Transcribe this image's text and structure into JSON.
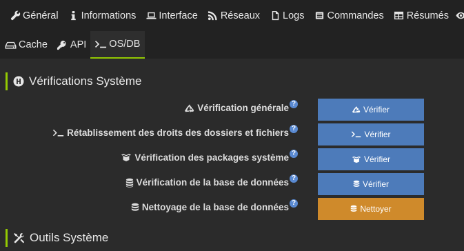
{
  "top_nav": [
    {
      "label": "Général",
      "icon": "wrench-icon"
    },
    {
      "label": "Informations",
      "icon": "info-icon"
    },
    {
      "label": "Interface",
      "icon": "laptop-icon"
    },
    {
      "label": "Réseaux",
      "icon": "rss-icon"
    },
    {
      "label": "Logs",
      "icon": "file-icon"
    },
    {
      "label": "Commandes",
      "icon": "list-icon"
    },
    {
      "label": "Résumés",
      "icon": "table-icon"
    }
  ],
  "sub_nav": [
    {
      "label": "Cache",
      "icon": "hdd-icon"
    },
    {
      "label": "API",
      "icon": "key-icon"
    },
    {
      "label": "OS/DB",
      "icon": "terminal-icon",
      "active": true
    }
  ],
  "sections": {
    "verifications_title": "Vérifications Système",
    "tools_title": "Outils Système"
  },
  "rows": [
    {
      "label": "Vérification générale",
      "icon": "recycle-icon",
      "button": "Vérifier",
      "button_icon": "recycle-icon"
    },
    {
      "label": "Rétablissement des droits des dossiers et fichiers",
      "icon": "terminal-icon",
      "button": "Vérifier",
      "button_icon": "terminal-icon"
    },
    {
      "label": "Vérification des packages système",
      "icon": "box-icon",
      "button": "Vérifier",
      "button_icon": "box-icon"
    },
    {
      "label": "Vérification de la base de données",
      "icon": "database-icon",
      "button": "Vérifier",
      "button_icon": "database-icon"
    },
    {
      "label": "Nettoyage de la base de données",
      "icon": "database-icon",
      "button": "Nettoyer",
      "button_icon": "database-icon"
    }
  ],
  "help_glyph": "?",
  "colors": {
    "accent": "#94ca02",
    "primary_button": "#4d7bba",
    "warning_button": "#cf8a2b",
    "background": "#2b2b2b",
    "nav_background": "#222222"
  }
}
